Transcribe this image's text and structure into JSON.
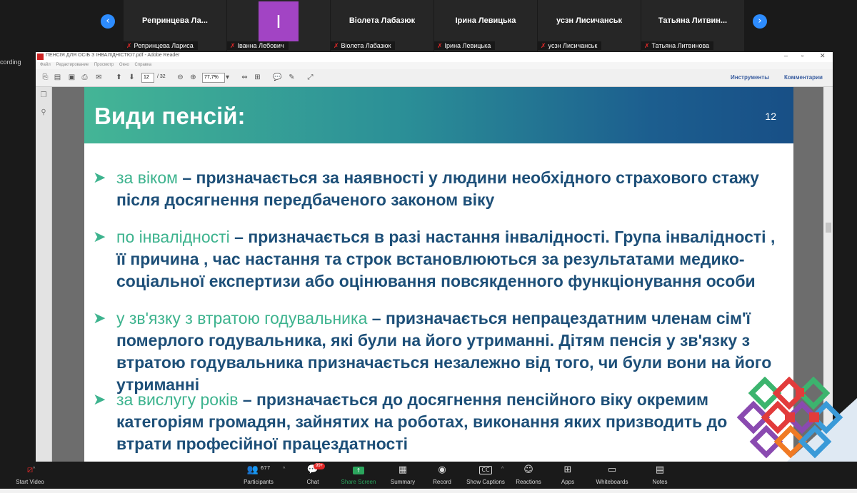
{
  "participants": [
    {
      "name": "Репринцева  Ла...",
      "sub": "Репринцева Лариса",
      "muted": true
    },
    {
      "name": "",
      "sub": "Іванна Лебович",
      "muted": true,
      "avatar_letter": "I"
    },
    {
      "name": "Віолета Лабазюк",
      "sub": "Віолета Лабазюк",
      "muted": true
    },
    {
      "name": "Ірина Левицька",
      "sub": "Ірина Левицька",
      "muted": true
    },
    {
      "name": "усзн Лисичанськ",
      "sub": "усзн Лисичанськ",
      "muted": true
    },
    {
      "name": "Татьяна  Литвин...",
      "sub": "Татьяна Литвинова",
      "muted": true
    }
  ],
  "recording_label": "cording",
  "reader": {
    "title": "ПЕНСІЯ ДЛЯ ОСІБ З ІНВАЛІДНІСТЮ7.pdf - Adobe Reader",
    "menu": [
      "Файл",
      "Редактирование",
      "Просмотр",
      "Окно",
      "Справка"
    ],
    "page_current": "12",
    "page_total": "/ 32",
    "zoom": "77,7%",
    "tools_link": "Инструменты",
    "comments_link": "Комментарии"
  },
  "slide": {
    "title": "Види пенсій:",
    "number": "12",
    "bullets": [
      {
        "term": "за віком",
        "text": " – призначається за наявності у людини необхідного страхового стажу після досягнення передбаченого законом віку"
      },
      {
        "term": "по інвалідності",
        "text": " – призначається в разі настання інвалідності.  Група  інвалідності , її причина , час настання та строк встановлюються за результатами медико-соціальної експертизи або оцінювання повсякденного функціонування особи"
      },
      {
        "term": "у зв'язку з втратою годувальника",
        "text": " – призначається непрацездатним членам сім'ї померлого годувальника, які були на його утриманні. Дітям пенсія у зв'язку з втратою годувальника призначається незалежно від того, чи були вони на його утриманні"
      },
      {
        "term": "за вислугу років",
        "text": " – призначається до досягнення пенсійного віку окремим категоріям громадян, зайнятих на роботах, виконання яких призводить до втрати професійної працездатності"
      }
    ],
    "colors": {
      "term": "#3db38e",
      "text": "#1d4f78"
    }
  },
  "zoom_bar": {
    "start_video": "Start Video",
    "participants_count": "677",
    "participants": "Participants",
    "chat": "Chat",
    "chat_badge": "99+",
    "share_screen": "Share Screen",
    "summary": "Summary",
    "record": "Record",
    "show_captions": "Show Captions",
    "reactions": "Reactions",
    "apps": "Apps",
    "whiteboards": "Whiteboards",
    "notes": "Notes"
  }
}
